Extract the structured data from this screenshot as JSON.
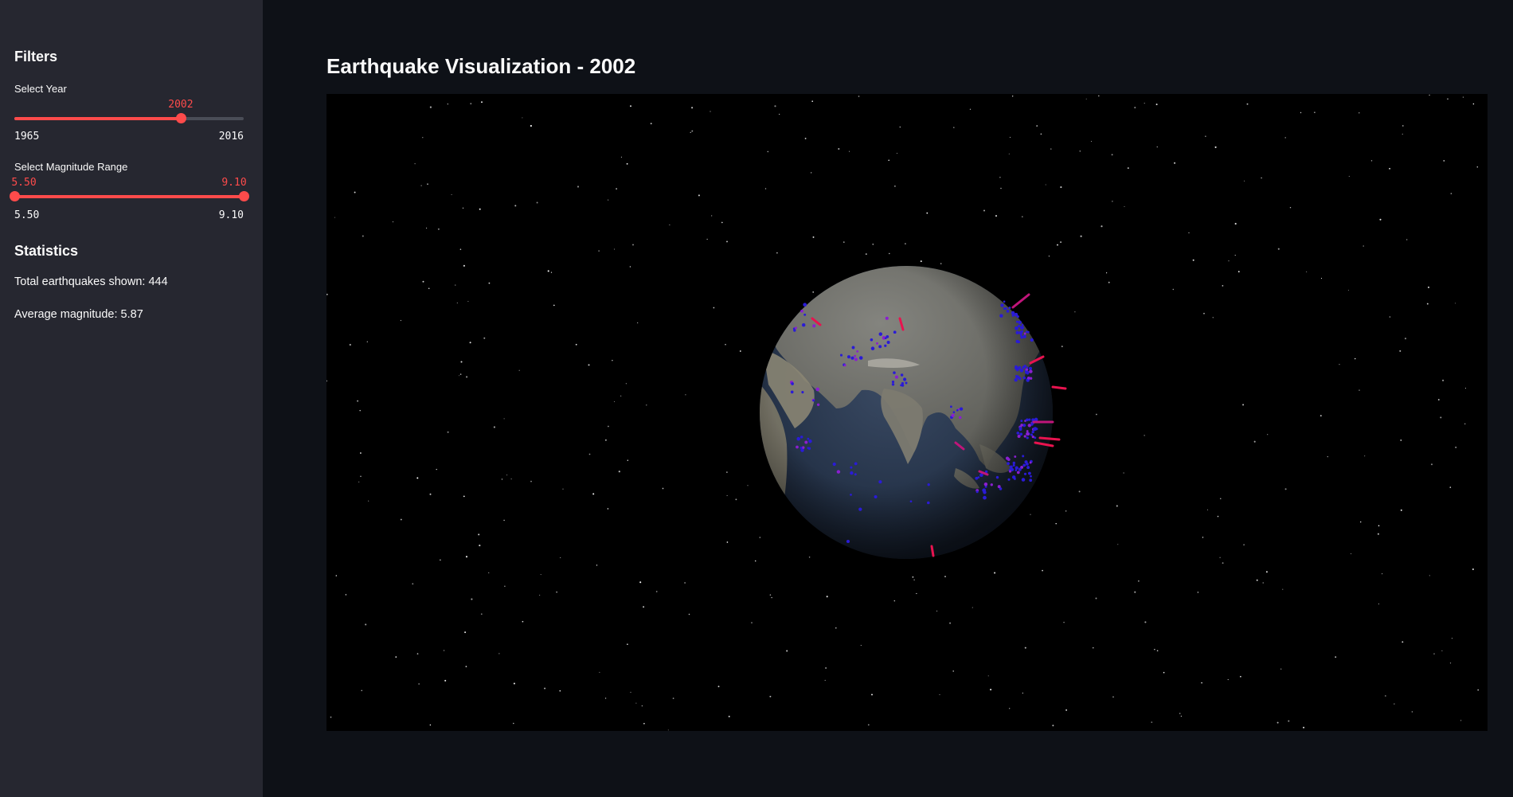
{
  "sidebar": {
    "filters_heading": "Filters",
    "year_slider": {
      "label": "Select Year",
      "min_label": "1965",
      "max_label": "2016",
      "min": 1965,
      "max": 2016,
      "value": 2002,
      "value_label": "2002"
    },
    "magnitude_slider": {
      "label": "Select Magnitude Range",
      "min_label": "5.50",
      "max_label": "9.10",
      "min": 5.5,
      "max": 9.1,
      "low": 5.5,
      "high": 9.1,
      "low_label": "5.50",
      "high_label": "9.10"
    },
    "statistics_heading": "Statistics",
    "total_text": "Total earthquakes shown: 444",
    "average_text": "Average magnitude: 5.87"
  },
  "main": {
    "title": "Earthquake Visualization - 2002"
  },
  "colors": {
    "accent": "#ff4b4b",
    "sidebar_bg": "#262730",
    "app_bg": "#0e1117",
    "viz_bg": "#000000",
    "quake_low": "#2a1bd6",
    "quake_high": "#e8134f"
  }
}
